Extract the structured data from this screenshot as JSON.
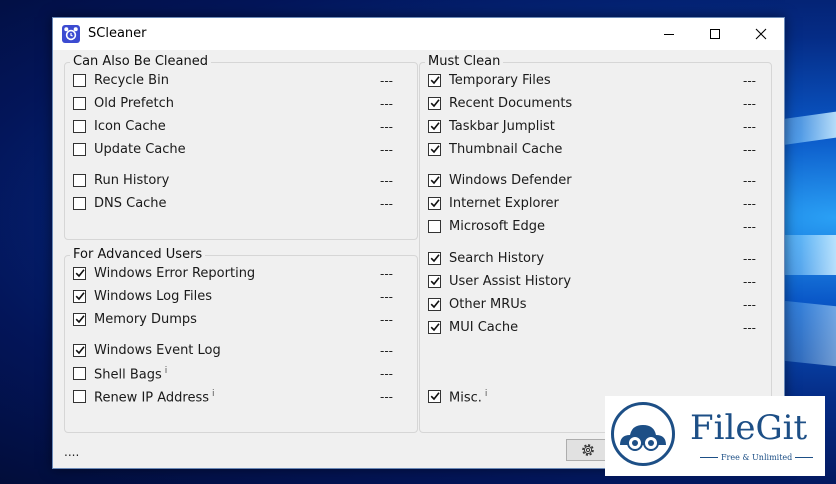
{
  "window": {
    "title": "SCleaner"
  },
  "groups": {
    "also": {
      "label": "Can Also Be Cleaned",
      "items": [
        {
          "label": "Recycle Bin",
          "checked": false,
          "value": "---"
        },
        {
          "label": "Old Prefetch",
          "checked": false,
          "value": "---"
        },
        {
          "label": "Icon Cache",
          "checked": false,
          "value": "---"
        },
        {
          "label": "Update Cache",
          "checked": false,
          "value": "---"
        },
        {
          "label": "Run History",
          "checked": false,
          "value": "---"
        },
        {
          "label": "DNS Cache",
          "checked": false,
          "value": "---"
        }
      ]
    },
    "advanced": {
      "label": "For Advanced Users",
      "items": [
        {
          "label": "Windows Error Reporting",
          "checked": true,
          "value": "---"
        },
        {
          "label": "Windows Log Files",
          "checked": true,
          "value": "---"
        },
        {
          "label": "Memory Dumps",
          "checked": true,
          "value": "---"
        },
        {
          "label": "Windows Event Log",
          "checked": true,
          "value": "---"
        },
        {
          "label": "Shell Bags",
          "checked": false,
          "value": "---",
          "info": "i"
        },
        {
          "label": "Renew IP Address",
          "checked": false,
          "value": "---",
          "info": "i"
        }
      ]
    },
    "must": {
      "label": "Must Clean",
      "items": [
        {
          "label": "Temporary Files",
          "checked": true,
          "value": "---"
        },
        {
          "label": "Recent Documents",
          "checked": true,
          "value": "---"
        },
        {
          "label": "Taskbar Jumplist",
          "checked": true,
          "value": "---"
        },
        {
          "label": "Thumbnail Cache",
          "checked": true,
          "value": "---"
        },
        {
          "label": "Windows Defender",
          "checked": true,
          "value": "---"
        },
        {
          "label": "Internet Explorer",
          "checked": true,
          "value": "---"
        },
        {
          "label": "Microsoft Edge",
          "checked": false,
          "value": "---"
        },
        {
          "label": "Search History",
          "checked": true,
          "value": "---"
        },
        {
          "label": "User Assist History",
          "checked": true,
          "value": "---"
        },
        {
          "label": "Other MRUs",
          "checked": true,
          "value": "---"
        },
        {
          "label": "MUI Cache",
          "checked": true,
          "value": "---"
        },
        {
          "label": "Misc.",
          "checked": true,
          "value": "",
          "info": "i"
        }
      ]
    }
  },
  "status": {
    "text": "...."
  },
  "watermark": {
    "brand": "FileGit",
    "tagline": "Free & Unlimited"
  },
  "icons": {
    "app": "alarm-clock-icon",
    "settings": "gear-icon",
    "minimize": "minimize-icon",
    "maximize": "maximize-icon",
    "close": "close-icon"
  },
  "colors": {
    "accent": "#3c4bd1",
    "watermark": "#1d4f86"
  }
}
